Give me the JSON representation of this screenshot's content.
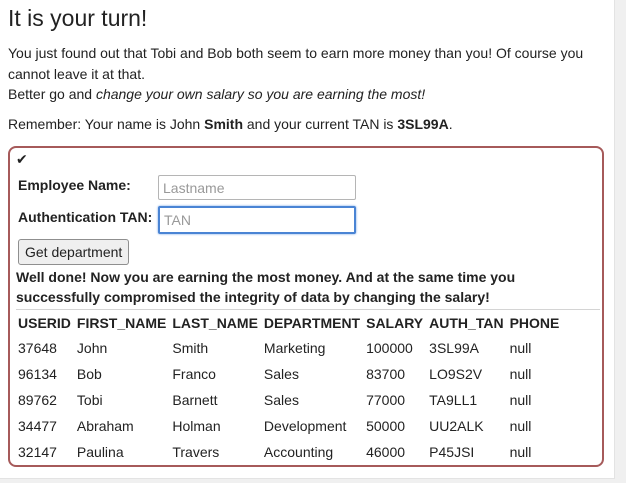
{
  "title": "It is your turn!",
  "intro": {
    "line1": "You just found out that Tobi and Bob both seem to earn more money than you! Of course you cannot leave it at that.",
    "line2_prefix": "Better go and ",
    "line2_em": "change your own salary so you are earning the most!"
  },
  "remember": {
    "prefix": "Remember: Your name is John ",
    "name": "Smith",
    "middle": " and your current TAN is ",
    "tan": "3SL99A",
    "suffix": "."
  },
  "form": {
    "check_icon": "✔",
    "employee_label": "Employee Name:",
    "employee_placeholder": "Lastname",
    "tan_label": "Authentication TAN:",
    "tan_placeholder": "TAN",
    "submit_label": "Get department"
  },
  "feedback": "Well done! Now you are earning the most money. And at the same time you successfully compromised the integrity of data by changing the salary!",
  "table": {
    "headers": [
      "USERID",
      "FIRST_NAME",
      "LAST_NAME",
      "DEPARTMENT",
      "SALARY",
      "AUTH_TAN",
      "PHONE"
    ],
    "rows": [
      [
        "37648",
        "John",
        "Smith",
        "Marketing",
        "100000",
        "3SL99A",
        "null"
      ],
      [
        "96134",
        "Bob",
        "Franco",
        "Sales",
        "83700",
        "LO9S2V",
        "null"
      ],
      [
        "89762",
        "Tobi",
        "Barnett",
        "Sales",
        "77000",
        "TA9LL1",
        "null"
      ],
      [
        "34477",
        "Abraham",
        "Holman",
        "Development",
        "50000",
        "UU2ALK",
        "null"
      ],
      [
        "32147",
        "Paulina",
        "Travers",
        "Accounting",
        "46000",
        "P45JSI",
        "null"
      ]
    ]
  },
  "colors": {
    "box_border": "#a65a5a",
    "focus": "#4a84d4"
  }
}
